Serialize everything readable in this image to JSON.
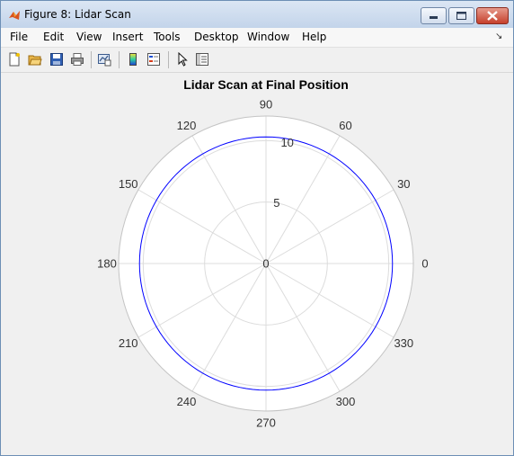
{
  "window": {
    "title": "Figure 8: Lidar Scan"
  },
  "menu": {
    "items": [
      "File",
      "Edit",
      "View",
      "Insert",
      "Tools",
      "Desktop",
      "Window",
      "Help"
    ]
  },
  "toolbar": {
    "icons": [
      "new-figure-icon",
      "open-file-icon",
      "save-icon",
      "print-icon",
      "link-plot-icon",
      "colorbar-icon",
      "legend-icon",
      "edit-plot-pointer-icon",
      "property-inspector-icon"
    ]
  },
  "colors": {
    "series": "#0000ff",
    "grid": "#dcdcdc",
    "axes_background": "#ffffff",
    "figure_background": "#f0f0f0"
  },
  "chart_data": {
    "type": "line",
    "projection": "polar",
    "title": "Lidar Scan at Final Position",
    "theta_ticks": [
      "0",
      "30",
      "60",
      "90",
      "120",
      "150",
      "180",
      "210",
      "240",
      "270",
      "300",
      "330"
    ],
    "r_ticks": [
      "0",
      "5",
      "10"
    ],
    "rlim": [
      0,
      12
    ],
    "grid": true,
    "series": [
      {
        "theta_deg": [
          0,
          30,
          60,
          90,
          120,
          150,
          180,
          210,
          240,
          270,
          300,
          330,
          360
        ],
        "r": [
          10.3,
          10.3,
          10.3,
          10.3,
          10.3,
          10.3,
          10.3,
          10.3,
          10.3,
          10.3,
          10.3,
          10.3,
          10.3
        ]
      }
    ]
  }
}
